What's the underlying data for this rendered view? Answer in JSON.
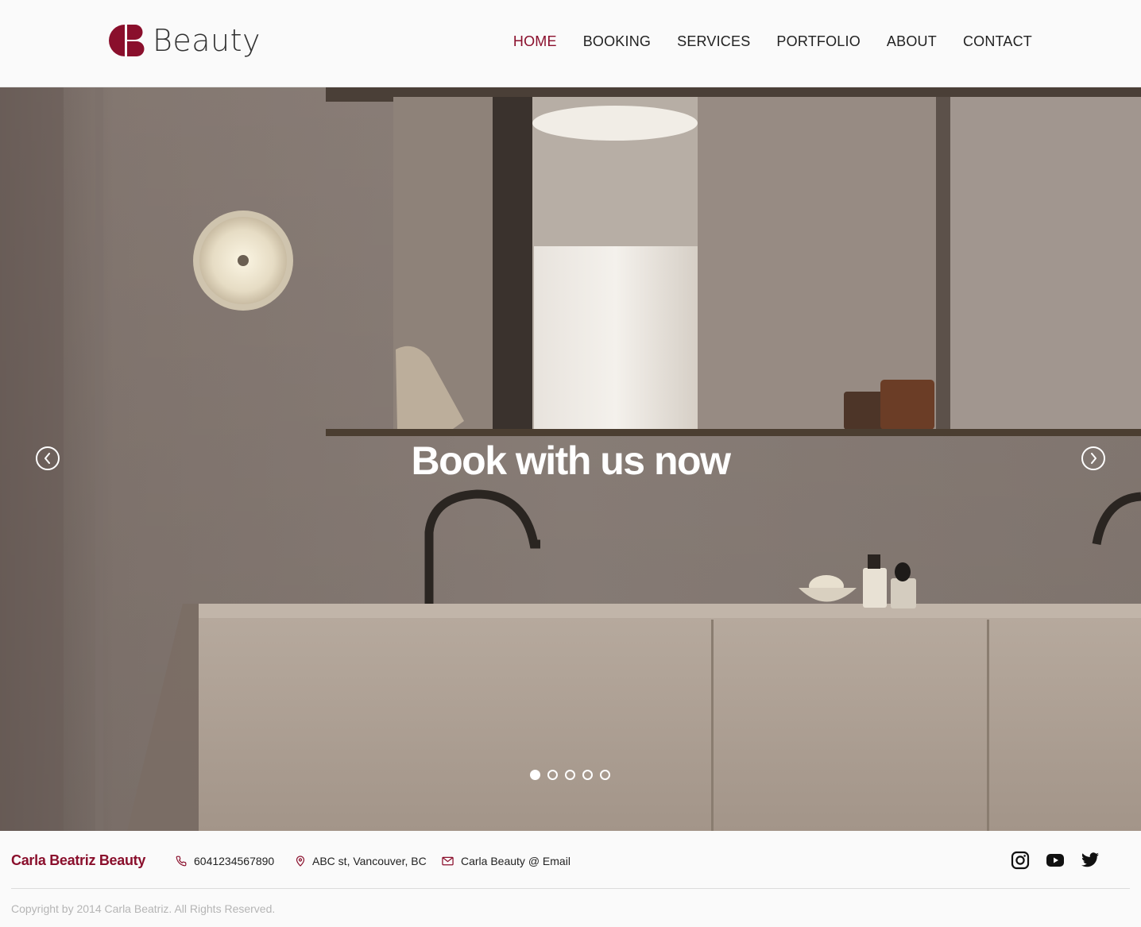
{
  "header": {
    "logo_text": "Beauty",
    "logo_initials_icon": "cb-monogram-icon",
    "nav": [
      {
        "label": "HOME",
        "active": true
      },
      {
        "label": "BOOKING",
        "active": false
      },
      {
        "label": "SERVICES",
        "active": false
      },
      {
        "label": "PORTFOLIO",
        "active": false
      },
      {
        "label": "ABOUT",
        "active": false
      },
      {
        "label": "CONTACT",
        "active": false
      }
    ]
  },
  "hero": {
    "title": "Book with us now",
    "prev_icon": "chevron-left-circle-icon",
    "next_icon": "chevron-right-circle-icon",
    "slides_count": 5,
    "active_slide": 1
  },
  "footer": {
    "brand": "Carla Beatriz Beauty",
    "phone": "6041234567890",
    "address": "ABC st, Vancouver, BC",
    "email": "Carla Beauty @ Email",
    "social": [
      "instagram-icon",
      "youtube-icon",
      "twitter-icon"
    ],
    "copyright": "Copyright by 2014 Carla Beatriz. All Rights Reserved."
  },
  "colors": {
    "brand": "#8a0f2c",
    "text": "#222222",
    "muted": "#b5b5b5",
    "background": "#fafafa"
  }
}
